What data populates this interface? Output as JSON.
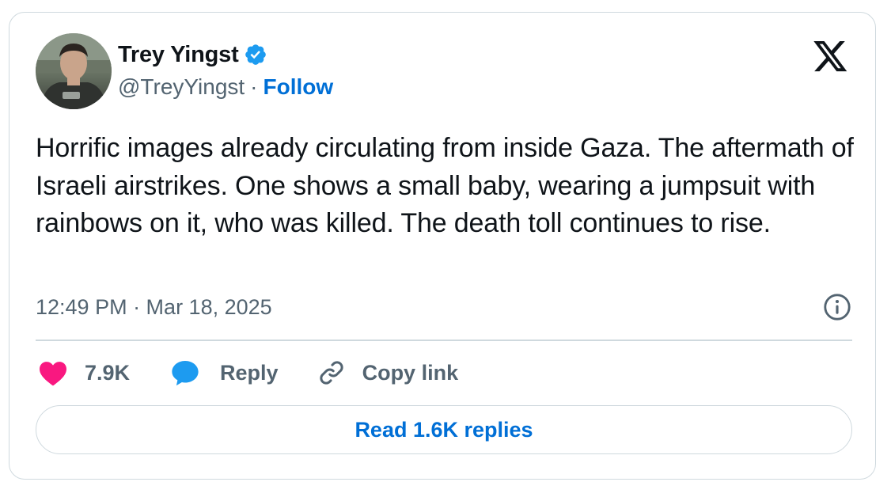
{
  "author": {
    "display_name": "Trey Yingst",
    "handle": "@TreyYingst",
    "separator": "·",
    "follow_label": "Follow",
    "verified": true
  },
  "tweet": {
    "text": "Horrific images already circulating from inside Gaza. The aftermath of Israeli airstrikes. One shows a small baby, wearing a jumpsuit with rainbows on it, who was killed. The death toll continues to rise.",
    "timestamp": "12:49 PM · Mar 18, 2025"
  },
  "actions": {
    "like_count": "7.9K",
    "reply_label": "Reply",
    "copy_link_label": "Copy link"
  },
  "read_replies_label": "Read 1.6K replies",
  "icons": {
    "brand": "x-logo-icon",
    "verified": "verified-badge-icon",
    "info": "info-icon",
    "like": "heart-icon",
    "reply": "speech-bubble-icon",
    "copy_link": "link-icon"
  },
  "colors": {
    "text_primary": "#0f1419",
    "text_secondary": "#536471",
    "link_blue": "#006fd6",
    "verified_blue": "#1d9bf0",
    "like_pink": "#f91880",
    "border": "#cfd9de"
  }
}
